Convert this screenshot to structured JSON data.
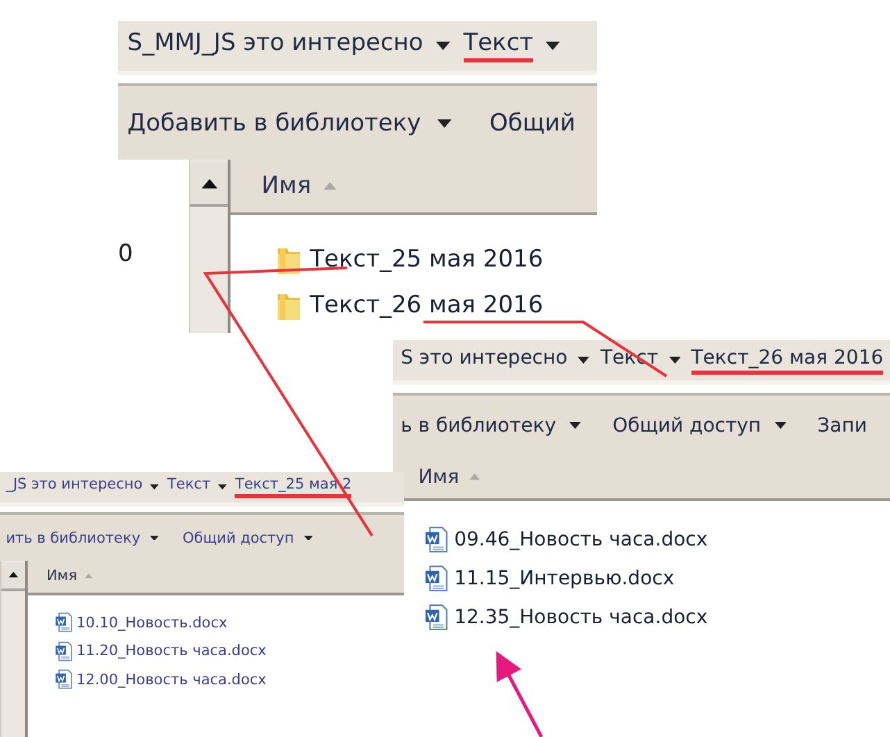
{
  "panels": [
    {
      "breadcrumbs": [
        {
          "text": "S_MMJ_JS это интересно",
          "dropdown": true,
          "marked": false
        },
        {
          "text": "Текст",
          "dropdown": true,
          "marked": true
        }
      ],
      "toolbar": [
        {
          "label": "Добавить в библиотеку",
          "dropdown": true
        },
        {
          "label": "Общий",
          "dropdown": false
        }
      ],
      "nav_pane": true,
      "nav_items": [
        "0"
      ],
      "column_header": "Имя",
      "files": [
        {
          "kind": "folder",
          "name": "Текст_25 мая 2016"
        },
        {
          "kind": "folder",
          "name": "Текст_26 мая 2016"
        }
      ]
    },
    {
      "breadcrumbs": [
        {
          "text": "S это интересно",
          "dropdown": true,
          "marked": false
        },
        {
          "text": "Текст",
          "dropdown": true,
          "marked": false
        },
        {
          "text": "Текст_26 мая 2016",
          "dropdown": false,
          "marked": true
        }
      ],
      "toolbar": [
        {
          "label": "ь в библиотеку",
          "dropdown": true
        },
        {
          "label": "Общий доступ",
          "dropdown": true
        },
        {
          "label": "Запи",
          "dropdown": false
        }
      ],
      "nav_pane": false,
      "column_header": "Имя",
      "files": [
        {
          "kind": "document",
          "name": "09.46_Новость часа.docx"
        },
        {
          "kind": "document",
          "name": "11.15_Интервью.docx"
        },
        {
          "kind": "document",
          "name": "12.35_Новость часа.docx"
        }
      ]
    },
    {
      "breadcrumbs": [
        {
          "text": "_JS это интересно",
          "dropdown": true,
          "marked": false
        },
        {
          "text": "Текст",
          "dropdown": true,
          "marked": false
        },
        {
          "text": "Текст_25 мая 2",
          "dropdown": false,
          "marked": true
        }
      ],
      "toolbar": [
        {
          "label": "ить в библиотеку",
          "dropdown": true
        },
        {
          "label": "Общий доступ",
          "dropdown": true
        }
      ],
      "nav_pane": true,
      "column_header": "Имя",
      "files": [
        {
          "kind": "document",
          "name": "10.10_Новость.docx"
        },
        {
          "kind": "document",
          "name": "11.20_Новость часа.docx"
        },
        {
          "kind": "document",
          "name": "12.00_Новость часа.docx"
        }
      ]
    }
  ]
}
